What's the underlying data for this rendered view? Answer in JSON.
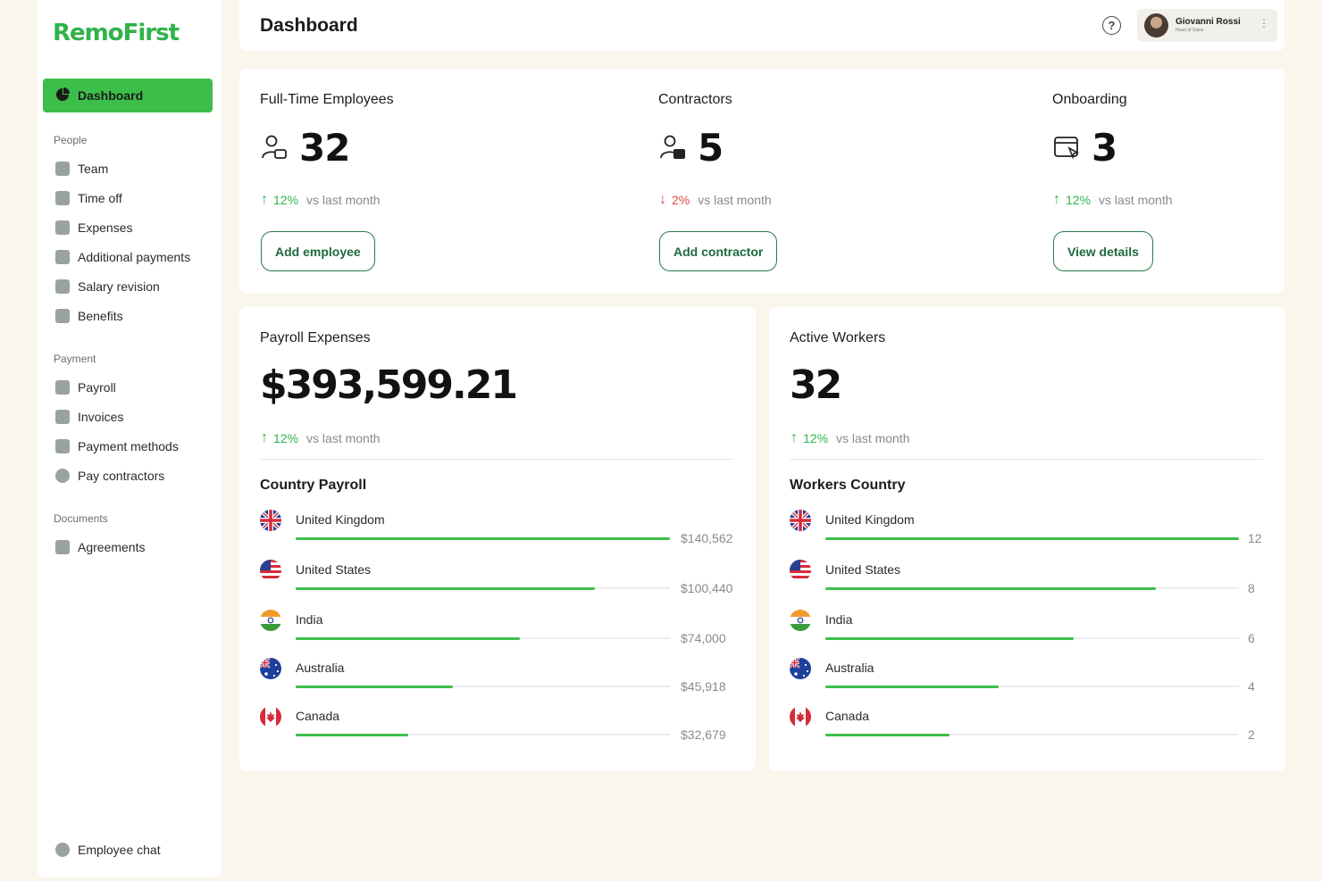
{
  "app": {
    "name": "RemoFirst"
  },
  "header": {
    "title": "Dashboard",
    "help": "?"
  },
  "user": {
    "name": "Giovanni Rossi",
    "role": "Head of Sales"
  },
  "sidebar": {
    "active": "Dashboard",
    "sections": [
      {
        "label": "People",
        "items": [
          "Team",
          "Time off",
          "Expenses",
          "Additional payments",
          "Salary revision",
          "Benefits"
        ]
      },
      {
        "label": "Payment",
        "items": [
          "Payroll",
          "Invoices",
          "Payment methods",
          "Pay contractors"
        ]
      },
      {
        "label": "Documents",
        "items": [
          "Agreements"
        ]
      }
    ],
    "footer": "Employee chat"
  },
  "stats": [
    {
      "title": "Full-Time Employees",
      "value": "32",
      "trend_dir": "up",
      "pct": "12%",
      "vs": "vs last month",
      "button": "Add employee"
    },
    {
      "title": "Contractors",
      "value": "5",
      "trend_dir": "down",
      "pct": "2%",
      "vs": "vs last month",
      "button": "Add contractor"
    },
    {
      "title": "Onboarding",
      "value": "3",
      "trend_dir": "up",
      "pct": "12%",
      "vs": "vs last month",
      "button": "View details"
    }
  ],
  "payroll": {
    "title": "Payroll Expenses",
    "value": "$393,599.21",
    "pct": "12%",
    "vs": "vs last month",
    "subtitle": "Country Payroll",
    "rows": [
      {
        "country": "United Kingdom",
        "amount": "$140,562",
        "share": 1.0
      },
      {
        "country": "United States",
        "amount": "$100,440",
        "share": 0.8
      },
      {
        "country": "India",
        "amount": "$74,000",
        "share": 0.6
      },
      {
        "country": "Australia",
        "amount": "$45,918",
        "share": 0.42
      },
      {
        "country": "Canada",
        "amount": "$32,679",
        "share": 0.3
      }
    ]
  },
  "workers": {
    "title": "Active Workers",
    "value": "32",
    "pct": "12%",
    "vs": "vs last month",
    "subtitle": "Workers Country",
    "rows": [
      {
        "country": "United Kingdom",
        "count": "12",
        "share": 1.0
      },
      {
        "country": "United States",
        "count": "8",
        "share": 0.8
      },
      {
        "country": "India",
        "count": "6",
        "share": 0.6
      },
      {
        "country": "Australia",
        "count": "4",
        "share": 0.42
      },
      {
        "country": "Canada",
        "count": "2",
        "share": 0.3
      }
    ]
  },
  "colors": {
    "accent": "#3cbf4a",
    "brand": "#2fb34a",
    "down": "#e04a3a",
    "background": "#faf6ec"
  }
}
